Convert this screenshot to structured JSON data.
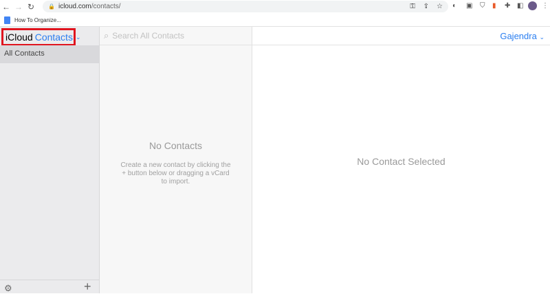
{
  "browser": {
    "url_host": "icloud.com",
    "url_path": "/contacts/",
    "bookmark": "How To Organize..."
  },
  "app": {
    "title_prefix": "iCloud",
    "title_app": "Contacts",
    "user": "Gajendra"
  },
  "sidebar": {
    "items": [
      {
        "label": "All Contacts"
      }
    ]
  },
  "list": {
    "search_placeholder": "Search All Contacts",
    "empty_title": "No Contacts",
    "empty_hint": "Create a new contact by clicking the + button below or dragging a vCard to import."
  },
  "detail": {
    "empty": "No Contact Selected"
  },
  "colors": {
    "accent": "#2a7ef0",
    "highlight": "#e0141e"
  }
}
